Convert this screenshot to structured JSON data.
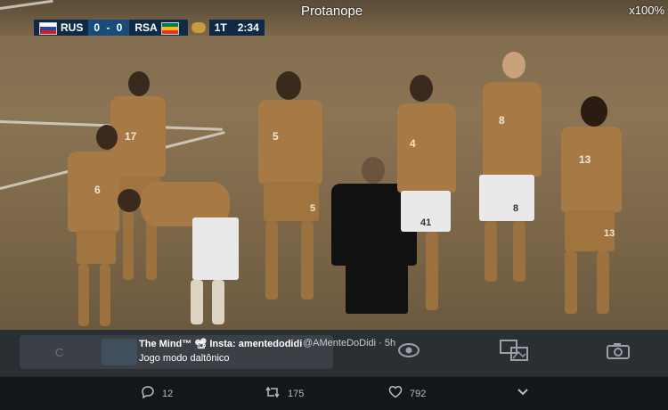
{
  "overlay": {
    "filter_label": "Protanope",
    "zoom_label": "x100%"
  },
  "scorebug": {
    "home_team": "RUS",
    "score": "0 - 0",
    "away_team": "RSA",
    "period": "1T",
    "clock": "2:34"
  },
  "players": {
    "numbers": [
      "17",
      "6",
      "5",
      "5",
      "4",
      "41",
      "8",
      "8",
      "13",
      "13"
    ]
  },
  "tweet": {
    "author_name": "The Mind™ 📽 Insta: amentedodidi",
    "handle_time": "@AMenteDoDidi · 5h",
    "text": "Jogo modo daltônico",
    "card_ghost_letter": "C"
  },
  "actions": {
    "reply_count": "12",
    "retweet_count": "175",
    "like_count": "792"
  },
  "icons": {
    "eye": "eye-icon",
    "gallery": "gallery-icon",
    "camera": "camera-icon",
    "reply": "reply-icon",
    "retweet": "retweet-icon",
    "like": "heart-icon",
    "more": "chevron-down-icon"
  }
}
